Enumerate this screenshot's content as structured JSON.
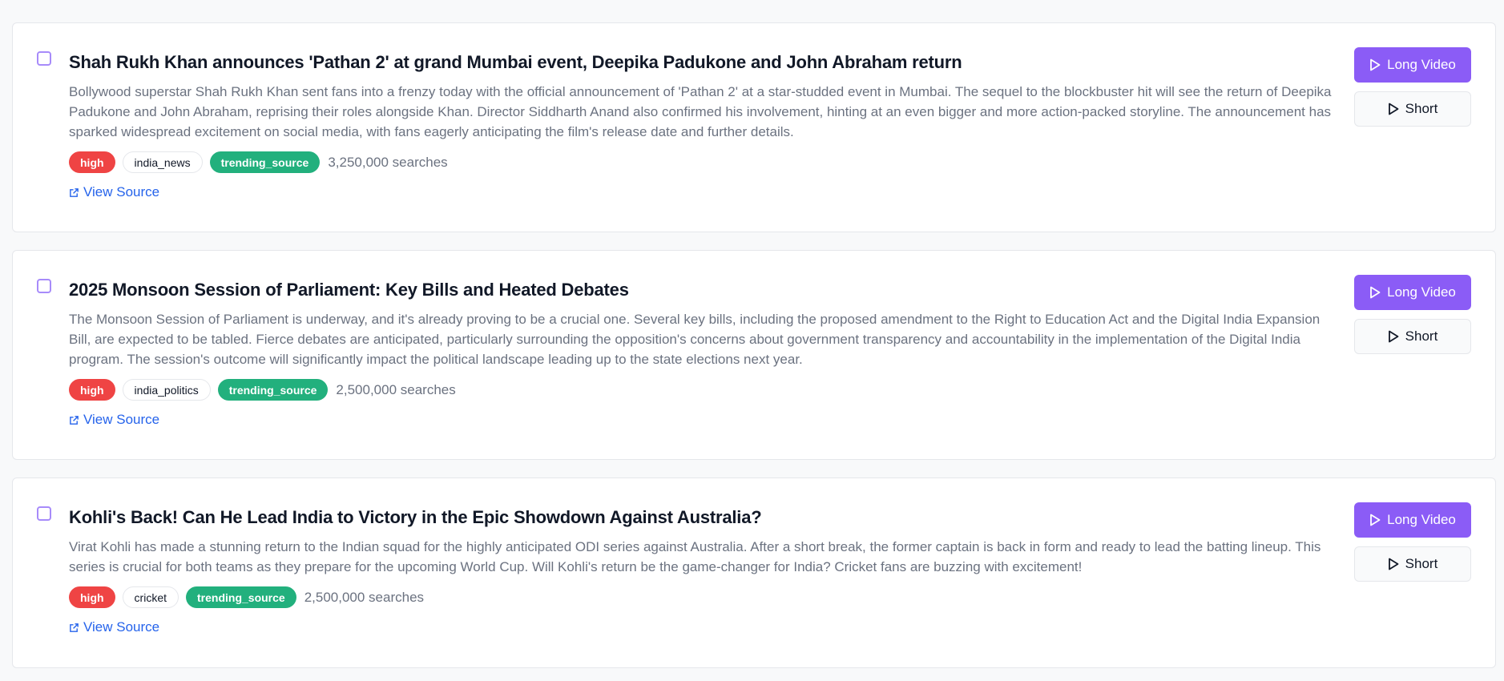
{
  "colors": {
    "accent": "#8b5cf6",
    "priority_high": "#ef4444",
    "source_badge": "#22b07d",
    "link": "#2563eb"
  },
  "icons": {
    "play": "play-icon",
    "external_link": "external-link-icon"
  },
  "buttons": {
    "long_video": "Long Video",
    "short": "Short"
  },
  "items": [
    {
      "title": "Shah Rukh Khan announces 'Pathan 2' at grand Mumbai event, Deepika Padukone and John Abraham return",
      "summary": "Bollywood superstar Shah Rukh Khan sent fans into a frenzy today with the official announcement of 'Pathan 2' at a star-studded event in Mumbai. The sequel to the blockbuster hit will see the return of Deepika Padukone and John Abraham, reprising their roles alongside Khan. Director Siddharth Anand also confirmed his involvement, hinting at an even bigger and more action-packed storyline. The announcement has sparked widespread excitement on social media, with fans eagerly anticipating the film's release date and further details.",
      "priority": "high",
      "category": "india_news",
      "source": "trending_source",
      "searches": "3,250,000 searches",
      "link": "View Source"
    },
    {
      "title": "2025 Monsoon Session of Parliament: Key Bills and Heated Debates",
      "summary": "The Monsoon Session of Parliament is underway, and it's already proving to be a crucial one. Several key bills, including the proposed amendment to the Right to Education Act and the Digital India Expansion Bill, are expected to be tabled. Fierce debates are anticipated, particularly surrounding the opposition's concerns about government transparency and accountability in the implementation of the Digital India program. The session's outcome will significantly impact the political landscape leading up to the state elections next year.",
      "priority": "high",
      "category": "india_politics",
      "source": "trending_source",
      "searches": "2,500,000 searches",
      "link": "View Source"
    },
    {
      "title": "Kohli's Back! Can He Lead India to Victory in the Epic Showdown Against Australia?",
      "summary": "Virat Kohli has made a stunning return to the Indian squad for the highly anticipated ODI series against Australia. After a short break, the former captain is back in form and ready to lead the batting lineup. This series is crucial for both teams as they prepare for the upcoming World Cup. Will Kohli's return be the game-changer for India? Cricket fans are buzzing with excitement!",
      "priority": "high",
      "category": "cricket",
      "source": "trending_source",
      "searches": "2,500,000 searches",
      "link": "View Source"
    }
  ]
}
